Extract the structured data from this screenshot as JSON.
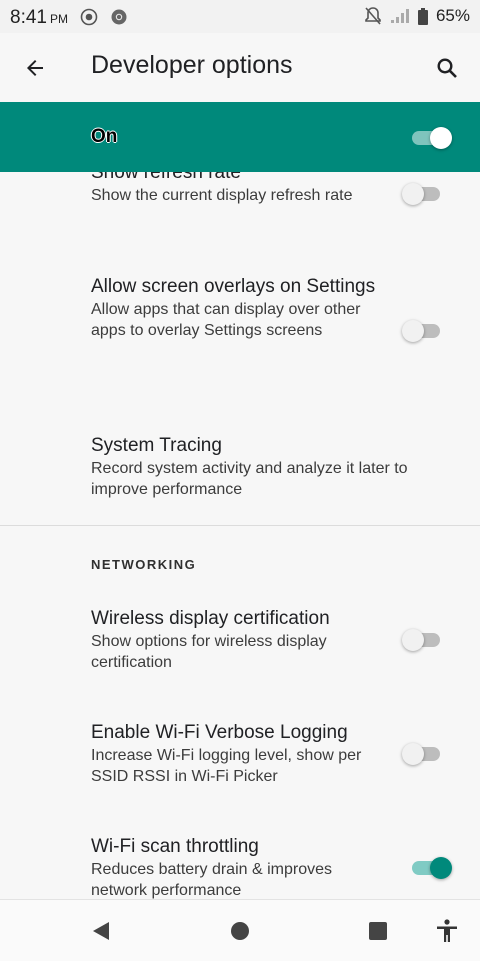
{
  "status": {
    "time": "8:41",
    "ampm": "PM",
    "battery_percent": "65%"
  },
  "appbar": {
    "title": "Developer options"
  },
  "master": {
    "label": "On",
    "enabled": true
  },
  "prefs": [
    {
      "title": "Show refresh rate",
      "summary": "Show the current display refresh rate",
      "enabled": false
    },
    {
      "title": "Allow screen overlays on Settings",
      "summary": "Allow apps that can display over other apps to overlay Settings screens",
      "enabled": false
    },
    {
      "title": "System Tracing",
      "summary": "Record system activity and analyze it later to improve performance"
    },
    {
      "title": "Wireless display certification",
      "summary": "Show options for wireless display certification",
      "enabled": false
    },
    {
      "title": "Enable Wi-Fi Verbose Logging",
      "summary": "Increase Wi-Fi logging level, show per SSID RSSI in Wi-Fi Picker",
      "enabled": false
    },
    {
      "title": "Wi-Fi scan throttling",
      "summary": "Reduces battery drain & improves network performance",
      "enabled": true
    }
  ],
  "sections": {
    "networking": "NETWORKING"
  },
  "icons": {
    "back": "arrow-back-icon",
    "search": "search-icon",
    "nav_back": "triangle-back-icon",
    "nav_home": "circle-home-icon",
    "nav_recents": "square-recents-icon",
    "accessibility": "accessibility-icon"
  },
  "colors": {
    "accent": "#00897b",
    "accent_light": "#80cbc4"
  }
}
